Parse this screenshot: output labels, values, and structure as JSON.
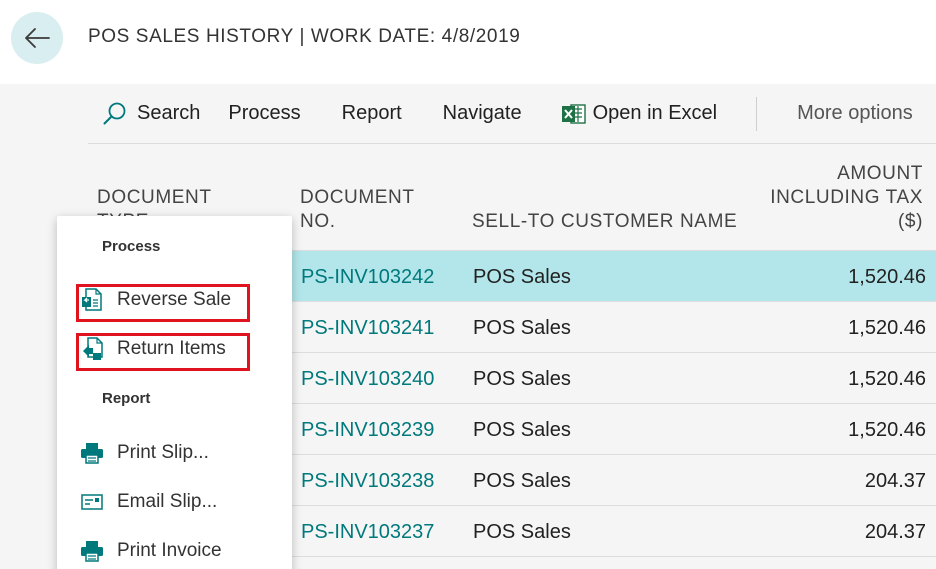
{
  "header": {
    "title": "POS SALES HISTORY | WORK DATE: 4/8/2019"
  },
  "icons": {
    "back": "arrow-left-icon",
    "search": "search-icon",
    "excel": "excel-icon",
    "reverse_sale": "reverse-document-icon",
    "return_items": "return-document-icon",
    "print": "printer-icon",
    "email": "email-card-icon"
  },
  "colors": {
    "accent_teal": "#00797c",
    "selected_row": "#b3e6ea",
    "back_circle": "#d9eef0",
    "highlight_red": "#e0141e",
    "excel_green": "#1e7145"
  },
  "action_bar": {
    "search": "Search",
    "process": "Process",
    "report": "Report",
    "navigate": "Navigate",
    "open_in_excel": "Open in Excel",
    "more_options": "More options"
  },
  "table": {
    "columns": {
      "document_type_1": "DOCUMENT",
      "document_type_2": "TYPE",
      "document_no_1": "DOCUMENT",
      "document_no_2": "NO.",
      "customer": "SELL-TO CUSTOMER NAME",
      "amount_1": "AMOUNT",
      "amount_2": "INCLUDING TAX",
      "amount_3": "($)"
    },
    "rows": [
      {
        "document_no": "PS-INV103242",
        "customer": "POS Sales",
        "amount": "1,520.46"
      },
      {
        "document_no": "PS-INV103241",
        "customer": "POS Sales",
        "amount": "1,520.46"
      },
      {
        "document_no": "PS-INV103240",
        "customer": "POS Sales",
        "amount": "1,520.46"
      },
      {
        "document_no": "PS-INV103239",
        "customer": "POS Sales",
        "amount": "1,520.46"
      },
      {
        "document_no": "PS-INV103238",
        "customer": "POS Sales",
        "amount": "204.37"
      },
      {
        "document_no": "PS-INV103237",
        "customer": "POS Sales",
        "amount": "204.37"
      }
    ]
  },
  "menu": {
    "process_header": "Process",
    "reverse_sale": "Reverse Sale",
    "return_items": "Return Items",
    "report_header": "Report",
    "print_slip": "Print Slip...",
    "email_slip": "Email Slip...",
    "print_invoice": "Print Invoice"
  }
}
